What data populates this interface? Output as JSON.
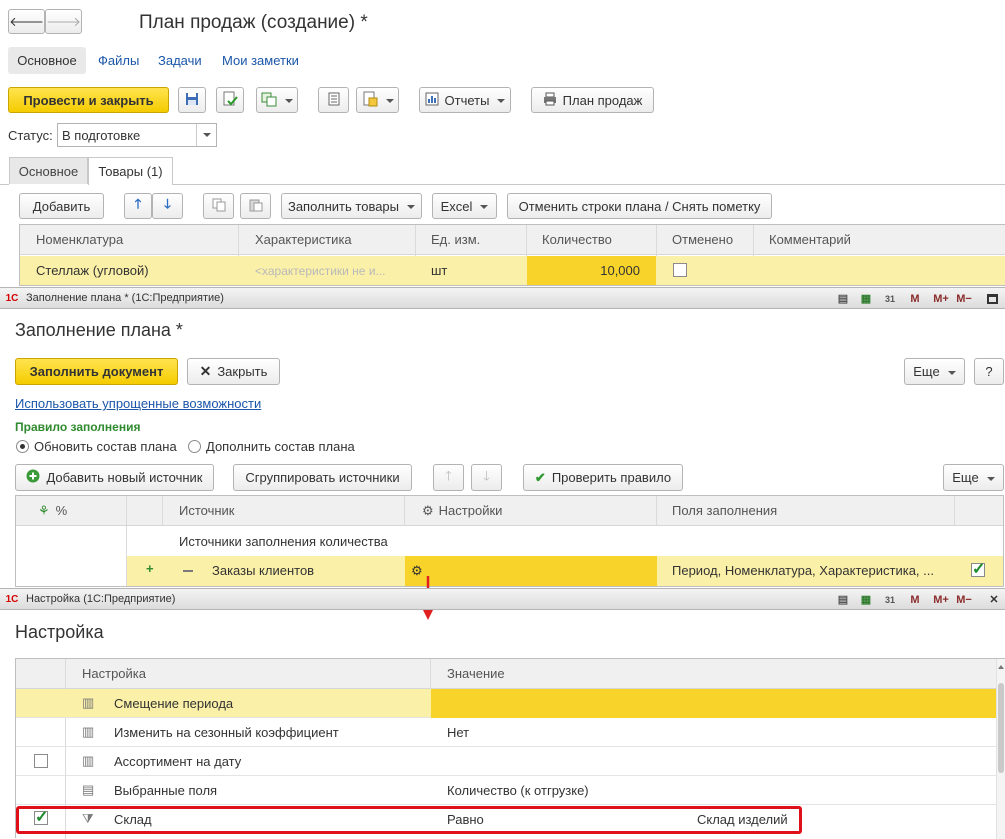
{
  "doc": {
    "title": "План продаж (создание) *",
    "nav": [
      "Основное",
      "Файлы",
      "Задачи",
      "Мои заметки"
    ],
    "post_close": "Провести и закрыть",
    "reports": "Отчеты",
    "plan_print": "План продаж",
    "status_label": "Статус:",
    "status_value": "В подготовке",
    "tabs": [
      "Основное",
      "Товары (1)"
    ],
    "add": "Добавить",
    "fill_goods": "Заполнить товары",
    "excel": "Excel",
    "cancel_rows": "Отменить строки плана / Снять пометку",
    "columns": [
      "Номенклатура",
      "Характеристика",
      "Ед. изм.",
      "Количество",
      "Отменено",
      "Комментарий"
    ],
    "row": {
      "nomenclature": "Стеллаж (угловой)",
      "characteristic": "<характеристики не и...",
      "unit": "шт",
      "quantity": "10,000"
    }
  },
  "fill_window": {
    "titlebar": "Заполнение плана * (1С:Предприятие)",
    "heading": "Заполнение плана *",
    "fill_btn": "Заполнить документ",
    "close_btn": "Закрыть",
    "more": "Еще",
    "help": "?",
    "simple_link": "Использовать упрощенные возможности",
    "rule_label": "Правило заполнения",
    "radio1": "Обновить состав плана",
    "radio2": "Дополнить состав плана",
    "add_source": "Добавить новый источник",
    "group_sources": "Сгруппировать источники",
    "check_rule": "Проверить правило",
    "more2": "Еще",
    "columns": [
      "%",
      "Источник",
      "Настройки",
      "Поля заполнения"
    ],
    "group_row": "Источники заполнения количества",
    "source_row": {
      "name": "Заказы клиентов",
      "fields": "Период, Номенклатура, Характеристика, ..."
    }
  },
  "settings_window": {
    "titlebar": "Настройка (1С:Предприятие)",
    "heading": "Настройка",
    "columns": [
      "Настройка",
      "Значение"
    ],
    "rows": [
      {
        "name": "Смещение периода",
        "value": "",
        "extra": ""
      },
      {
        "name": "Изменить на сезонный коэффициент",
        "value": "Нет",
        "extra": ""
      },
      {
        "name": "Ассортимент на дату",
        "value": "",
        "extra": ""
      },
      {
        "name": "Выбранные поля",
        "value": "Количество (к отгрузке)",
        "extra": ""
      },
      {
        "name": "Склад",
        "value": "Равно",
        "extra": "Склад изделий"
      }
    ]
  },
  "titlebar_icons": {
    "m": "M",
    "mplus": "M+",
    "mminus": "M−"
  }
}
